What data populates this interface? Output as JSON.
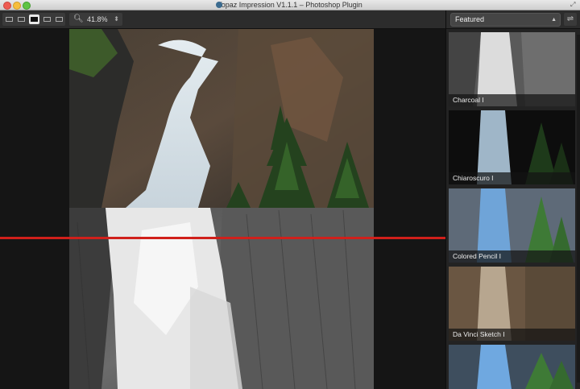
{
  "window": {
    "title": "Topaz Impression V1.1.1 – Photoshop Plugin"
  },
  "toolbar": {
    "view_modes": [
      "single-view",
      "split-horizontal",
      "split-vertical-active",
      "side-by-side",
      "stacked"
    ],
    "zoom_value": "41.8%"
  },
  "sidebar": {
    "preset_category": "Featured",
    "thumbnails": [
      {
        "label": "Charcoal I",
        "style": "charcoal"
      },
      {
        "label": "Chiaroscuro I",
        "style": "chiaroscuro"
      },
      {
        "label": "Colored Pencil I",
        "style": "colored-pencil"
      },
      {
        "label": "Da Vinci Sketch I",
        "style": "sketch"
      },
      {
        "label": "",
        "style": "partial"
      }
    ]
  },
  "colors": {
    "split_line": "#d0201b",
    "background": "#1c1c1c"
  }
}
